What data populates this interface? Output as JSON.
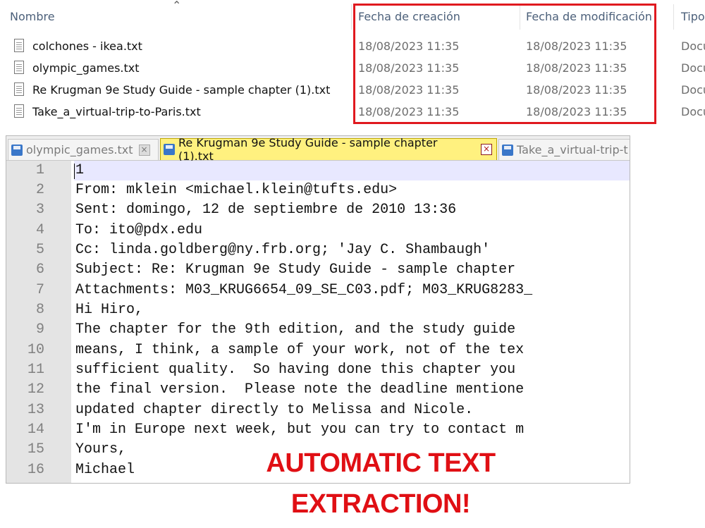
{
  "explorer": {
    "columns": {
      "name": "Nombre",
      "created": "Fecha de creación",
      "modified": "Fecha de modificación",
      "type": "Tipo"
    },
    "files": [
      {
        "name": "colchones - ikea.txt",
        "created": "18/08/2023 11:35",
        "modified": "18/08/2023 11:35",
        "type": "Docu"
      },
      {
        "name": "olympic_games.txt",
        "created": "18/08/2023 11:35",
        "modified": "18/08/2023 11:35",
        "type": "Docu"
      },
      {
        "name": "Re  Krugman 9e Study Guide - sample chapter (1).txt",
        "created": "18/08/2023 11:35",
        "modified": "18/08/2023 11:35",
        "type": "Docu"
      },
      {
        "name": "Take_a_virtual-trip-to-Paris.txt",
        "created": "18/08/2023 11:35",
        "modified": "18/08/2023 11:35",
        "type": "Docu"
      }
    ],
    "highlight_color": "#e0191f"
  },
  "editor": {
    "tabs": [
      {
        "label": "olympic_games.txt",
        "active": false
      },
      {
        "label": "Re  Krugman 9e Study Guide - sample chapter (1).txt",
        "active": true
      },
      {
        "label": "Take_a_virtual-trip-t",
        "active": false
      }
    ],
    "line_numbers": [
      "1",
      "2",
      "3",
      "4",
      "5",
      "6",
      "7",
      "8",
      "9",
      "10",
      "11",
      "12",
      "13",
      "14",
      "15",
      "16"
    ],
    "lines": [
      "1",
      "From: mklein <michael.klein@tufts.edu>",
      "Sent: domingo, 12 de septiembre de 2010 13:36",
      "To: ito@pdx.edu",
      "Cc: linda.goldberg@ny.frb.org; 'Jay C. Shambaugh'",
      "Subject: Re: Krugman 9e Study Guide - sample chapter",
      "Attachments: M03_KRUG6654_09_SE_C03.pdf; M03_KRUG8283_",
      "Hi Hiro,",
      "The chapter for the 9th edition, and the study guide",
      "means, I think, a sample of your work, not of the tex",
      "sufficient quality.  So having done this chapter you",
      "the final version.  Please note the deadline mentione",
      "updated chapter directly to Melissa and Nicole.",
      "I'm in Europe next week, but you can try to contact m",
      "Yours,",
      "Michael"
    ],
    "active_tab_color": "#fff17f"
  },
  "banner": {
    "line1": "AUTOMATIC TEXT",
    "line2": "EXTRACTION!",
    "color": "#e00f14"
  }
}
